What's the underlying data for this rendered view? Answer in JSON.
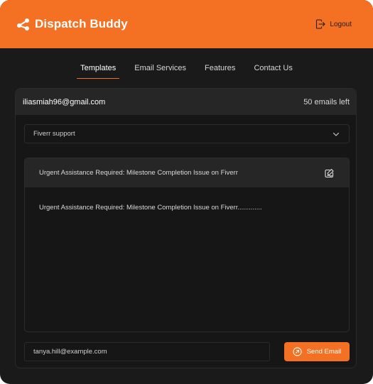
{
  "brand": {
    "name": "Dispatch Buddy",
    "icon": "share-nodes-icon"
  },
  "header": {
    "logout_label": "Logout",
    "logout_icon": "logout-icon"
  },
  "nav": {
    "tabs": [
      {
        "label": "Templates",
        "active": true
      },
      {
        "label": "Email Services",
        "active": false
      },
      {
        "label": "Features",
        "active": false
      },
      {
        "label": "Contact Us",
        "active": false
      }
    ]
  },
  "account": {
    "email": "iliasmiah96@gmail.com",
    "emails_left": "50 emails left"
  },
  "template_select": {
    "selected": "Fiverr support",
    "icon": "chevron-down-icon"
  },
  "editor": {
    "subject": "Urgent Assistance Required: Milestone Completion Issue on Fiverr",
    "subject_icon": "edit-icon",
    "body": "Urgent Assistance Required: Milestone Completion Issue on Fiverr............."
  },
  "recipient": {
    "value": "tanya.hill@example.com"
  },
  "send": {
    "label": "Send Email",
    "icon": "arrow-up-right-circle-icon"
  },
  "colors": {
    "accent": "#f47023",
    "background": "#1a1a1a",
    "panel": "#262626"
  }
}
